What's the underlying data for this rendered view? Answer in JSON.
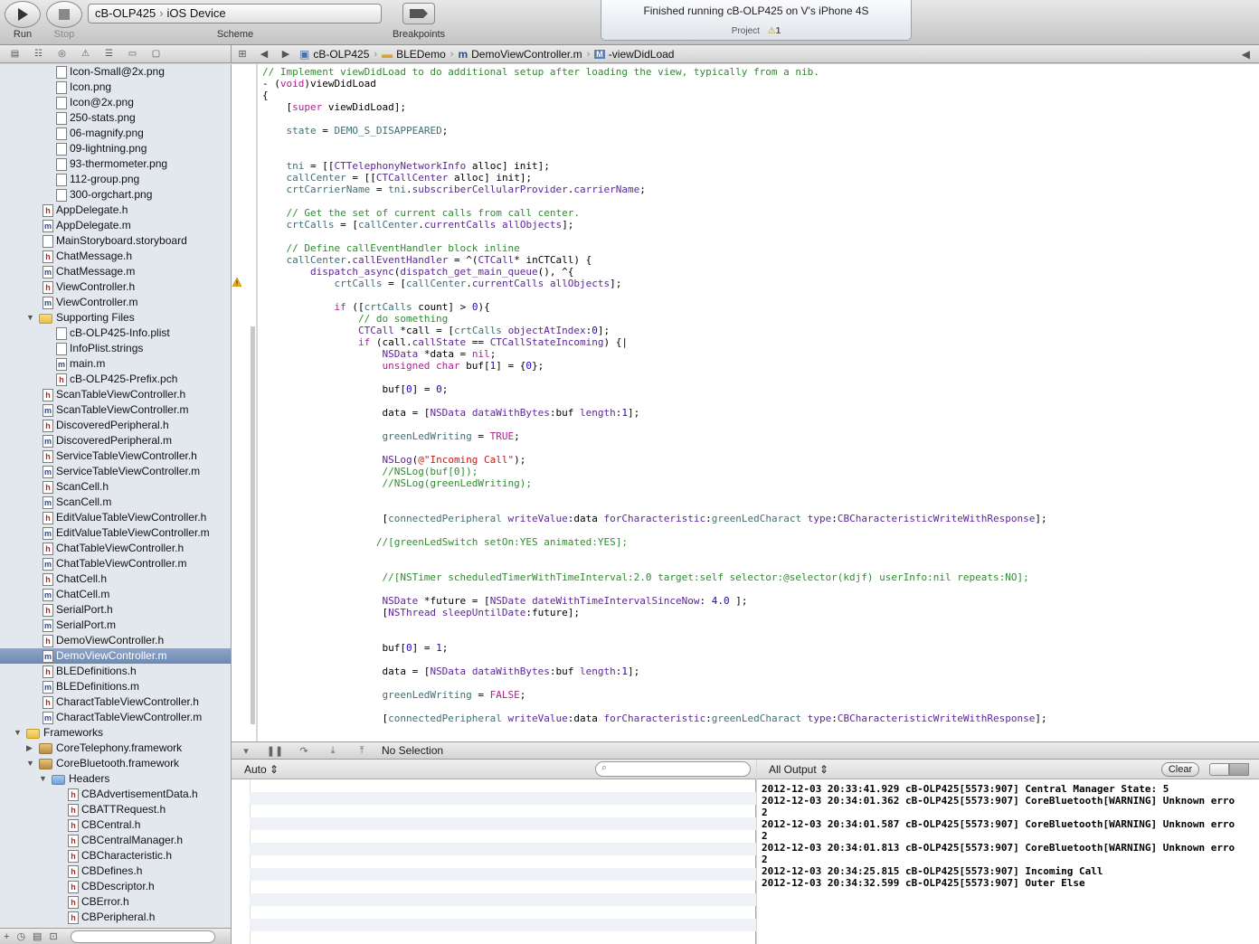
{
  "toolbar": {
    "run_label": "Run",
    "stop_label": "Stop",
    "scheme_target": "cB-OLP425",
    "scheme_device": "iOS Device",
    "scheme_label": "Scheme",
    "breakpoints_label": "Breakpoints",
    "status_text": "Finished running cB-OLP425 on V's iPhone 4S",
    "status_project": "Project",
    "status_warning_count": "1"
  },
  "jumpbar": {
    "items": [
      "cB-OLP425",
      "BLEDemo",
      "DemoViewController.m",
      "-viewDidLoad"
    ]
  },
  "navigator": {
    "rows": [
      {
        "name": "Icon-Small@2x.png",
        "type": "file",
        "indent": 62
      },
      {
        "name": "Icon.png",
        "type": "file",
        "indent": 62
      },
      {
        "name": "Icon@2x.png",
        "type": "file",
        "indent": 62
      },
      {
        "name": "250-stats.png",
        "type": "file",
        "indent": 62
      },
      {
        "name": "06-magnify.png",
        "type": "file",
        "indent": 62
      },
      {
        "name": "09-lightning.png",
        "type": "file",
        "indent": 62
      },
      {
        "name": "93-thermometer.png",
        "type": "file",
        "indent": 62
      },
      {
        "name": "112-group.png",
        "type": "file",
        "indent": 62
      },
      {
        "name": "300-orgchart.png",
        "type": "file",
        "indent": 62
      },
      {
        "name": "AppDelegate.h",
        "type": "h",
        "indent": 47
      },
      {
        "name": "AppDelegate.m",
        "type": "m",
        "indent": 47
      },
      {
        "name": "MainStoryboard.storyboard",
        "type": "file",
        "indent": 47
      },
      {
        "name": "ChatMessage.h",
        "type": "h",
        "indent": 47
      },
      {
        "name": "ChatMessage.m",
        "type": "m",
        "indent": 47
      },
      {
        "name": "ViewController.h",
        "type": "h",
        "indent": 47
      },
      {
        "name": "ViewController.m",
        "type": "m",
        "indent": 47
      },
      {
        "name": "Supporting Files",
        "type": "folder",
        "indent": 43,
        "disclosure": "open"
      },
      {
        "name": "cB-OLP425-Info.plist",
        "type": "file",
        "indent": 62
      },
      {
        "name": "InfoPlist.strings",
        "type": "file",
        "indent": 62
      },
      {
        "name": "main.m",
        "type": "m",
        "indent": 62
      },
      {
        "name": "cB-OLP425-Prefix.pch",
        "type": "h",
        "indent": 62
      },
      {
        "name": "ScanTableViewController.h",
        "type": "h",
        "indent": 47
      },
      {
        "name": "ScanTableViewController.m",
        "type": "m",
        "indent": 47
      },
      {
        "name": "DiscoveredPeripheral.h",
        "type": "h",
        "indent": 47
      },
      {
        "name": "DiscoveredPeripheral.m",
        "type": "m",
        "indent": 47
      },
      {
        "name": "ServiceTableViewController.h",
        "type": "h",
        "indent": 47
      },
      {
        "name": "ServiceTableViewController.m",
        "type": "m",
        "indent": 47
      },
      {
        "name": "ScanCell.h",
        "type": "h",
        "indent": 47
      },
      {
        "name": "ScanCell.m",
        "type": "m",
        "indent": 47
      },
      {
        "name": "EditValueTableViewController.h",
        "type": "h",
        "indent": 47
      },
      {
        "name": "EditValueTableViewController.m",
        "type": "m",
        "indent": 47
      },
      {
        "name": "ChatTableViewController.h",
        "type": "h",
        "indent": 47
      },
      {
        "name": "ChatTableViewController.m",
        "type": "m",
        "indent": 47
      },
      {
        "name": "ChatCell.h",
        "type": "h",
        "indent": 47
      },
      {
        "name": "ChatCell.m",
        "type": "m",
        "indent": 47
      },
      {
        "name": "SerialPort.h",
        "type": "h",
        "indent": 47
      },
      {
        "name": "SerialPort.m",
        "type": "m",
        "indent": 47
      },
      {
        "name": "DemoViewController.h",
        "type": "h",
        "indent": 47
      },
      {
        "name": "DemoViewController.m",
        "type": "m",
        "indent": 47,
        "selected": true
      },
      {
        "name": "BLEDefinitions.h",
        "type": "h",
        "indent": 47
      },
      {
        "name": "BLEDefinitions.m",
        "type": "m",
        "indent": 47
      },
      {
        "name": "CharactTableViewController.h",
        "type": "h",
        "indent": 47
      },
      {
        "name": "CharactTableViewController.m",
        "type": "m",
        "indent": 47
      },
      {
        "name": "Frameworks",
        "type": "folder",
        "indent": 29,
        "disclosure": "open"
      },
      {
        "name": "CoreTelephony.framework",
        "type": "fw",
        "indent": 43,
        "disclosure": "closed"
      },
      {
        "name": "CoreBluetooth.framework",
        "type": "fw",
        "indent": 43,
        "disclosure": "open"
      },
      {
        "name": "Headers",
        "type": "hdrf",
        "indent": 57,
        "disclosure": "open"
      },
      {
        "name": "CBAdvertisementData.h",
        "type": "h",
        "indent": 75
      },
      {
        "name": "CBATTRequest.h",
        "type": "h",
        "indent": 75
      },
      {
        "name": "CBCentral.h",
        "type": "h",
        "indent": 75
      },
      {
        "name": "CBCentralManager.h",
        "type": "h",
        "indent": 75
      },
      {
        "name": "CBCharacteristic.h",
        "type": "h",
        "indent": 75
      },
      {
        "name": "CBDefines.h",
        "type": "h",
        "indent": 75
      },
      {
        "name": "CBDescriptor.h",
        "type": "h",
        "indent": 75
      },
      {
        "name": "CBError.h",
        "type": "h",
        "indent": 75
      },
      {
        "name": "CBPeripheral.h",
        "type": "h",
        "indent": 75
      }
    ]
  },
  "editor": {
    "lines": [
      [
        [
          "c-com",
          "// Implement viewDidLoad to do additional setup after loading the view, typically from a nib."
        ]
      ],
      [
        [
          "",
          "- ("
        ],
        [
          "c-kw",
          "void"
        ],
        [
          "",
          ")viewDidLoad"
        ]
      ],
      [
        [
          "",
          "{"
        ]
      ],
      [
        [
          "",
          "    ["
        ],
        [
          "c-kw",
          "super"
        ],
        [
          "",
          " viewDidLoad];"
        ]
      ],
      [],
      [
        [
          "",
          "    "
        ],
        [
          "c-prj",
          "state"
        ],
        [
          "",
          " = "
        ],
        [
          "c-prj",
          "DEMO_S_DISAPPEARED"
        ],
        [
          "",
          ";"
        ]
      ],
      [],
      [],
      [
        [
          "",
          "    "
        ],
        [
          "c-prj",
          "tni"
        ],
        [
          "",
          " = [["
        ],
        [
          "c-cls",
          "CTTelephonyNetworkInfo"
        ],
        [
          "",
          " alloc] init];"
        ]
      ],
      [
        [
          "",
          "    "
        ],
        [
          "c-prj",
          "callCenter"
        ],
        [
          "",
          " = [["
        ],
        [
          "c-cls",
          "CTCallCenter"
        ],
        [
          "",
          " alloc] init];"
        ]
      ],
      [
        [
          "",
          "    "
        ],
        [
          "c-prj",
          "crtCarrierName"
        ],
        [
          "",
          " = "
        ],
        [
          "c-prj",
          "tni"
        ],
        [
          "",
          "."
        ],
        [
          "c-cls",
          "subscriberCellularProvider"
        ],
        [
          "",
          "."
        ],
        [
          "c-cls",
          "carrierName"
        ],
        [
          "",
          ";"
        ]
      ],
      [],
      [
        [
          "",
          "    "
        ],
        [
          "c-com",
          "// Get the set of current calls from call center."
        ]
      ],
      [
        [
          "",
          "    "
        ],
        [
          "c-prj",
          "crtCalls"
        ],
        [
          "",
          " = ["
        ],
        [
          "c-prj",
          "callCenter"
        ],
        [
          "",
          "."
        ],
        [
          "c-cls",
          "currentCalls"
        ],
        [
          "",
          " "
        ],
        [
          "c-cls",
          "allObjects"
        ],
        [
          "",
          "];"
        ]
      ],
      [],
      [
        [
          "",
          "    "
        ],
        [
          "c-com",
          "// Define callEventHandler block inline"
        ]
      ],
      [
        [
          "",
          "    "
        ],
        [
          "c-prj",
          "callCenter"
        ],
        [
          "",
          "."
        ],
        [
          "c-cls",
          "callEventHandler"
        ],
        [
          "",
          " = ^("
        ],
        [
          "c-cls",
          "CTCall"
        ],
        [
          "",
          "* inCTCall) {"
        ]
      ],
      [
        [
          "",
          "        "
        ],
        [
          "c-cls",
          "dispatch_async"
        ],
        [
          "",
          "("
        ],
        [
          "c-cls",
          "dispatch_get_main_queue"
        ],
        [
          "",
          "(), ^{"
        ]
      ],
      [
        [
          "",
          "            "
        ],
        [
          "c-prj",
          "crtCalls"
        ],
        [
          "",
          " = ["
        ],
        [
          "c-prj",
          "callCenter"
        ],
        [
          "",
          "."
        ],
        [
          "c-cls",
          "currentCalls"
        ],
        [
          "",
          " "
        ],
        [
          "c-cls",
          "allObjects"
        ],
        [
          "",
          "];"
        ]
      ],
      [],
      [
        [
          "",
          "            "
        ],
        [
          "c-kw",
          "if"
        ],
        [
          "",
          " (["
        ],
        [
          "c-prj",
          "crtCalls"
        ],
        [
          "",
          " count] > "
        ],
        [
          "c-num",
          "0"
        ],
        [
          "",
          "){"
        ]
      ],
      [
        [
          "",
          "                "
        ],
        [
          "c-com",
          "// do something"
        ]
      ],
      [
        [
          "",
          "                "
        ],
        [
          "c-cls",
          "CTCall"
        ],
        [
          "",
          " *call = ["
        ],
        [
          "c-prj",
          "crtCalls"
        ],
        [
          "",
          " "
        ],
        [
          "c-cls",
          "objectAtIndex"
        ],
        [
          "",
          ":"
        ],
        [
          "c-num",
          "0"
        ],
        [
          "",
          "];"
        ]
      ],
      [
        [
          "",
          "                "
        ],
        [
          "c-kw",
          "if"
        ],
        [
          "",
          " (call."
        ],
        [
          "c-cls",
          "callState"
        ],
        [
          "",
          " == "
        ],
        [
          "c-cls",
          "CTCallStateIncoming"
        ],
        [
          "",
          ") {|"
        ]
      ],
      [
        [
          "",
          "                    "
        ],
        [
          "c-cls",
          "NSData"
        ],
        [
          "",
          " *data = "
        ],
        [
          "c-kw",
          "nil"
        ],
        [
          "",
          ";"
        ]
      ],
      [
        [
          "",
          "                    "
        ],
        [
          "c-kw",
          "unsigned char"
        ],
        [
          "",
          " buf["
        ],
        [
          "c-num",
          "1"
        ],
        [
          "",
          "] = {"
        ],
        [
          "c-num",
          "0"
        ],
        [
          "",
          "};"
        ]
      ],
      [],
      [
        [
          "",
          "                    buf["
        ],
        [
          "c-num",
          "0"
        ],
        [
          "",
          "] = "
        ],
        [
          "c-num",
          "0"
        ],
        [
          "",
          ";"
        ]
      ],
      [],
      [
        [
          "",
          "                    data = ["
        ],
        [
          "c-cls",
          "NSData"
        ],
        [
          "",
          " "
        ],
        [
          "c-cls",
          "dataWithBytes"
        ],
        [
          "",
          ":buf "
        ],
        [
          "c-cls",
          "length"
        ],
        [
          "",
          ":"
        ],
        [
          "c-num",
          "1"
        ],
        [
          "",
          "];"
        ]
      ],
      [],
      [
        [
          "",
          "                    "
        ],
        [
          "c-prj",
          "greenLedWriting"
        ],
        [
          "",
          " = "
        ],
        [
          "c-kw",
          "TRUE"
        ],
        [
          "",
          ";"
        ]
      ],
      [],
      [
        [
          "",
          "                    "
        ],
        [
          "c-cls",
          "NSLog"
        ],
        [
          "",
          "("
        ],
        [
          "c-str",
          "@\"Incoming Call\""
        ],
        [
          "",
          ");"
        ]
      ],
      [
        [
          "",
          "                    "
        ],
        [
          "c-com",
          "//NSLog(buf[0]);"
        ]
      ],
      [
        [
          "",
          "                    "
        ],
        [
          "c-com",
          "//NSLog(greenLedWriting);"
        ]
      ],
      [],
      [],
      [
        [
          "",
          "                    ["
        ],
        [
          "c-prj",
          "connectedPeripheral"
        ],
        [
          "",
          " "
        ],
        [
          "c-cls",
          "writeValue"
        ],
        [
          "",
          ":data "
        ],
        [
          "c-cls",
          "forCharacteristic"
        ],
        [
          "",
          ":"
        ],
        [
          "c-prj",
          "greenLedCharact"
        ],
        [
          "",
          " "
        ],
        [
          "c-cls",
          "type"
        ],
        [
          "",
          ":"
        ],
        [
          "c-cls",
          "CBCharacteristicWriteWithResponse"
        ],
        [
          "",
          "];"
        ]
      ],
      [],
      [
        [
          "",
          "                   "
        ],
        [
          "c-com",
          "//[greenLedSwitch setOn:YES animated:YES];"
        ]
      ],
      [],
      [],
      [
        [
          "",
          "                    "
        ],
        [
          "c-com",
          "//[NSTimer scheduledTimerWithTimeInterval:2.0 target:self selector:@selector(kdjf) userInfo:nil repeats:NO];"
        ]
      ],
      [],
      [
        [
          "",
          "                    "
        ],
        [
          "c-cls",
          "NSDate"
        ],
        [
          "",
          " *future = ["
        ],
        [
          "c-cls",
          "NSDate"
        ],
        [
          "",
          " "
        ],
        [
          "c-cls",
          "dateWithTimeIntervalSinceNow"
        ],
        [
          "",
          ": "
        ],
        [
          "c-num",
          "4.0"
        ],
        [
          "",
          " ];"
        ]
      ],
      [
        [
          "",
          "                    ["
        ],
        [
          "c-cls",
          "NSThread"
        ],
        [
          "",
          " "
        ],
        [
          "c-cls",
          "sleepUntilDate"
        ],
        [
          "",
          ":future];"
        ]
      ],
      [],
      [],
      [
        [
          "",
          "                    buf["
        ],
        [
          "c-num",
          "0"
        ],
        [
          "",
          "] = "
        ],
        [
          "c-num",
          "1"
        ],
        [
          "",
          ";"
        ]
      ],
      [],
      [
        [
          "",
          "                    data = ["
        ],
        [
          "c-cls",
          "NSData"
        ],
        [
          "",
          " "
        ],
        [
          "c-cls",
          "dataWithBytes"
        ],
        [
          "",
          ":buf "
        ],
        [
          "c-cls",
          "length"
        ],
        [
          "",
          ":"
        ],
        [
          "c-num",
          "1"
        ],
        [
          "",
          "];"
        ]
      ],
      [],
      [
        [
          "",
          "                    "
        ],
        [
          "c-prj",
          "greenLedWriting"
        ],
        [
          "",
          " = "
        ],
        [
          "c-kw",
          "FALSE"
        ],
        [
          "",
          ";"
        ]
      ],
      [],
      [
        [
          "",
          "                    ["
        ],
        [
          "c-prj",
          "connectedPeripheral"
        ],
        [
          "",
          " "
        ],
        [
          "c-cls",
          "writeValue"
        ],
        [
          "",
          ":data "
        ],
        [
          "c-cls",
          "forCharacteristic"
        ],
        [
          "",
          ":"
        ],
        [
          "c-prj",
          "greenLedCharact"
        ],
        [
          "",
          " "
        ],
        [
          "c-cls",
          "type"
        ],
        [
          "",
          ":"
        ],
        [
          "c-cls",
          "CBCharacteristicWriteWithResponse"
        ],
        [
          "",
          "];"
        ]
      ]
    ]
  },
  "debug": {
    "selection_label": "No Selection",
    "variables_scope": "Auto",
    "output_scope": "All Output",
    "clear_label": "Clear"
  },
  "console": {
    "lines": [
      "2012-12-03 20:33:41.929 cB-OLP425[5573:907] Central Manager State: 5",
      "2012-12-03 20:34:01.362 cB-OLP425[5573:907] CoreBluetooth[WARNING] Unknown erro",
      "2",
      "2012-12-03 20:34:01.587 cB-OLP425[5573:907] CoreBluetooth[WARNING] Unknown erro",
      "2",
      "2012-12-03 20:34:01.813 cB-OLP425[5573:907] CoreBluetooth[WARNING] Unknown erro",
      "2",
      "2012-12-03 20:34:25.815 cB-OLP425[5573:907] Incoming Call",
      "2012-12-03 20:34:32.599 cB-OLP425[5573:907] Outer Else"
    ]
  }
}
